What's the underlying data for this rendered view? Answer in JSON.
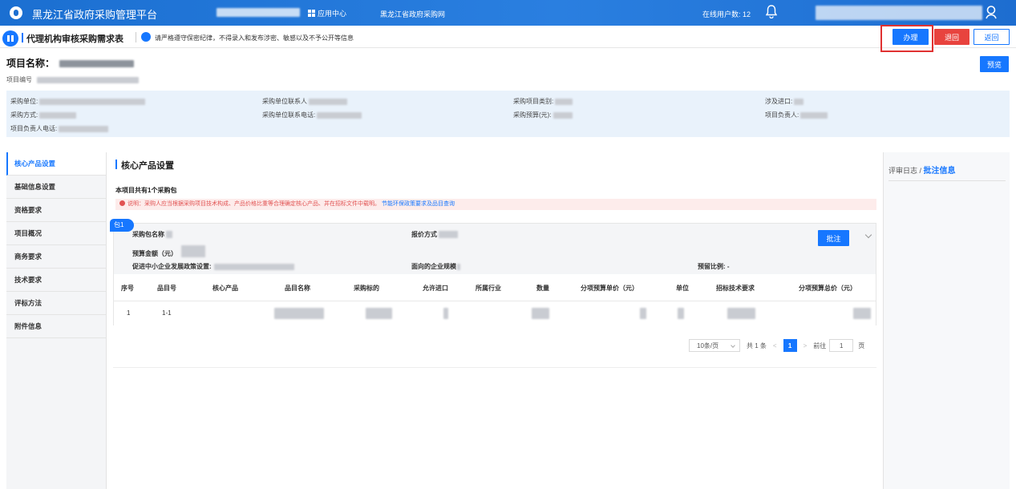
{
  "topbar": {
    "title": "黑龙江省政府采购管理平台",
    "app_center": "应用中心",
    "portal_link": "黑龙江省政府采购网",
    "online_label": "在线用户数:",
    "online_count": "12"
  },
  "header": {
    "page_title": "代理机构审核采购需求表",
    "notice": "请严格遵守保密纪律，不得录入和发布涉密、敏感以及不予公开等信息",
    "btn_handle": "办理",
    "btn_reject": "退回",
    "btn_back": "返回"
  },
  "project": {
    "name_label": "项目名称：",
    "code_label": "项目编号",
    "preview": "预览"
  },
  "info": {
    "unit": "采购单位:",
    "contact": "采购单位联系人",
    "category": "采购项目类别:",
    "import": "涉及进口:",
    "method": "采购方式:",
    "contact_phone": "采购单位联系电话:",
    "budget": "采购预算(元):",
    "leader": "项目负责人:",
    "leader_phone": "项目负责人电话:"
  },
  "nav": [
    "核心产品设置",
    "基础信息设置",
    "资格要求",
    "项目概况",
    "商务要求",
    "技术要求",
    "评标方法",
    "附件信息"
  ],
  "main": {
    "section_title": "核心产品设置",
    "package_count": "本项目共有1个采购包",
    "note": "说明：采购人应当根据采购项目技术构成、产品价格比重等合理确定核心产品、并在招标文件中载明。",
    "note_link": "节能环保政策要求及品目查询",
    "package": {
      "tag": "包1",
      "name_label": "采购包名称",
      "quote_label": "报价方式",
      "amount_label": "预算金额（元）",
      "sme_label": "促进中小企业发展政策设置:",
      "scale_label": "面向的企业规模",
      "reserve_label": "预留比例:",
      "reserve_value": "-",
      "approve": "批注",
      "headers": [
        "序号",
        "品目号",
        "核心产品",
        "品目名称",
        "采购标的",
        "允许进口",
        "所属行业",
        "数量",
        "分项预算单价（元）",
        "单位",
        "招标技术要求",
        "分项预算总价（元）"
      ],
      "row": {
        "index": "1",
        "item_no": "1-1"
      }
    },
    "pager": {
      "page_size": "10条/页",
      "total": "共 1 条",
      "current": "1",
      "goto": "前往",
      "goto_value": "1",
      "page_suffix": "页"
    }
  },
  "right": {
    "log": "评审日志 /",
    "comments": "批注信息"
  },
  "colors": {
    "accent": "#1677ff",
    "danger": "#e8433e",
    "highlight_box": "#e03131",
    "info_bg": "#e9f2fb"
  }
}
